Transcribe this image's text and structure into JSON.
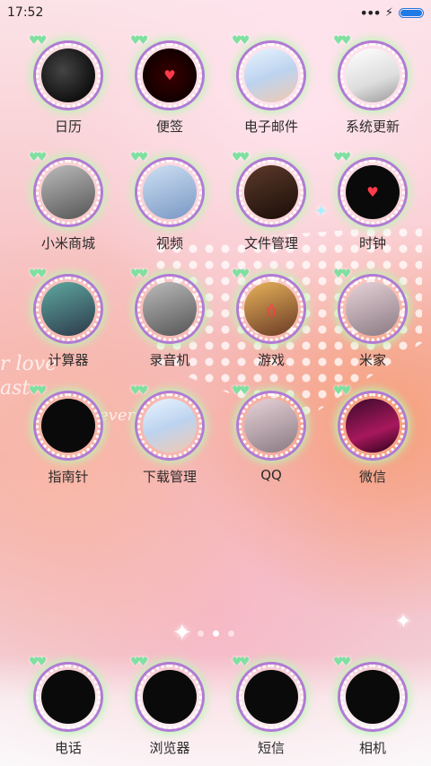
{
  "status_bar": {
    "time": "17:52",
    "overflow_icon": "more-dots-icon",
    "charging_icon": "lightning-icon",
    "battery_level": 1.0,
    "battery_color": "#1e7be5"
  },
  "wallpaper_text": [
    "r love",
    "ast",
    "ever"
  ],
  "apps": [
    {
      "label": "日历",
      "icon": "calendar-photo-icon",
      "theme": "p-dark",
      "glyph": ""
    },
    {
      "label": "便签",
      "icon": "notes-photo-icon",
      "theme": "p-red",
      "glyph": "♥"
    },
    {
      "label": "电子邮件",
      "icon": "email-photo-icon",
      "theme": "p-sky",
      "glyph": ""
    },
    {
      "label": "系统更新",
      "icon": "system-update-photo-icon",
      "theme": "p-white",
      "glyph": ""
    },
    {
      "label": "小米商城",
      "icon": "mi-store-photo-icon",
      "theme": "p-gray",
      "glyph": ""
    },
    {
      "label": "视频",
      "icon": "video-photo-icon",
      "theme": "p-blue",
      "glyph": ""
    },
    {
      "label": "文件管理",
      "icon": "file-manager-photo-icon",
      "theme": "p-sepia",
      "glyph": ""
    },
    {
      "label": "时钟",
      "icon": "clock-photo-icon",
      "theme": "p-black",
      "glyph": "♥"
    },
    {
      "label": "计算器",
      "icon": "calculator-photo-icon",
      "theme": "p-teal",
      "glyph": ""
    },
    {
      "label": "录音机",
      "icon": "recorder-photo-icon",
      "theme": "p-gray",
      "glyph": ""
    },
    {
      "label": "游戏",
      "icon": "games-photo-icon",
      "theme": "p-warm",
      "glyph": "ტ"
    },
    {
      "label": "米家",
      "icon": "mijia-photo-icon",
      "theme": "p-pink",
      "glyph": ""
    },
    {
      "label": "指南针",
      "icon": "compass-photo-icon",
      "theme": "p-black",
      "glyph": ""
    },
    {
      "label": "下载管理",
      "icon": "download-manager-photo-icon",
      "theme": "p-sky",
      "glyph": ""
    },
    {
      "label": "QQ",
      "icon": "qq-photo-icon",
      "theme": "p-pink",
      "glyph": ""
    },
    {
      "label": "微信",
      "icon": "wechat-photo-icon",
      "theme": "p-ruby",
      "glyph": ""
    }
  ],
  "pages": {
    "count": 3,
    "active_index": 1
  },
  "dock": [
    {
      "label": "电话",
      "icon": "phone-photo-icon",
      "theme": "p-black",
      "glyph": ""
    },
    {
      "label": "浏览器",
      "icon": "browser-photo-icon",
      "theme": "p-black",
      "glyph": ""
    },
    {
      "label": "短信",
      "icon": "messages-photo-icon",
      "theme": "p-black",
      "glyph": ""
    },
    {
      "label": "相机",
      "icon": "camera-photo-icon",
      "theme": "p-black",
      "glyph": ""
    }
  ]
}
